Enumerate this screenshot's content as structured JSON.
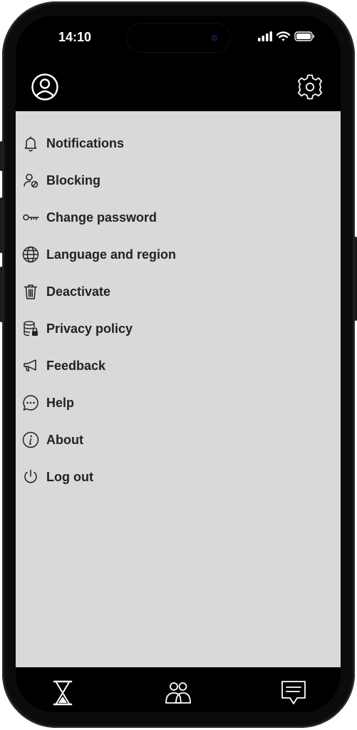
{
  "status_bar": {
    "time": "14:10"
  },
  "menu": {
    "items": [
      {
        "id": "notifications",
        "label": "Notifications",
        "icon": "bell-icon"
      },
      {
        "id": "blocking",
        "label": "Blocking",
        "icon": "user-blocked-icon"
      },
      {
        "id": "change-password",
        "label": "Change password",
        "icon": "key-icon"
      },
      {
        "id": "language",
        "label": "Language and region",
        "icon": "globe-icon"
      },
      {
        "id": "deactivate",
        "label": "Deactivate",
        "icon": "trash-icon"
      },
      {
        "id": "privacy",
        "label": "Privacy policy",
        "icon": "database-lock-icon"
      },
      {
        "id": "feedback",
        "label": "Feedback",
        "icon": "megaphone-icon"
      },
      {
        "id": "help",
        "label": "Help",
        "icon": "chat-bubble-icon"
      },
      {
        "id": "about",
        "label": "About",
        "icon": "info-icon"
      },
      {
        "id": "logout",
        "label": "Log out",
        "icon": "power-icon"
      }
    ]
  },
  "tabbar": {
    "tabs": [
      {
        "id": "timer",
        "icon": "hourglass-icon"
      },
      {
        "id": "friends",
        "icon": "people-icon"
      },
      {
        "id": "messages",
        "icon": "message-icon"
      }
    ]
  },
  "colors": {
    "panel": "#d9d9d9",
    "bars": "#000000",
    "text": "#222222"
  }
}
